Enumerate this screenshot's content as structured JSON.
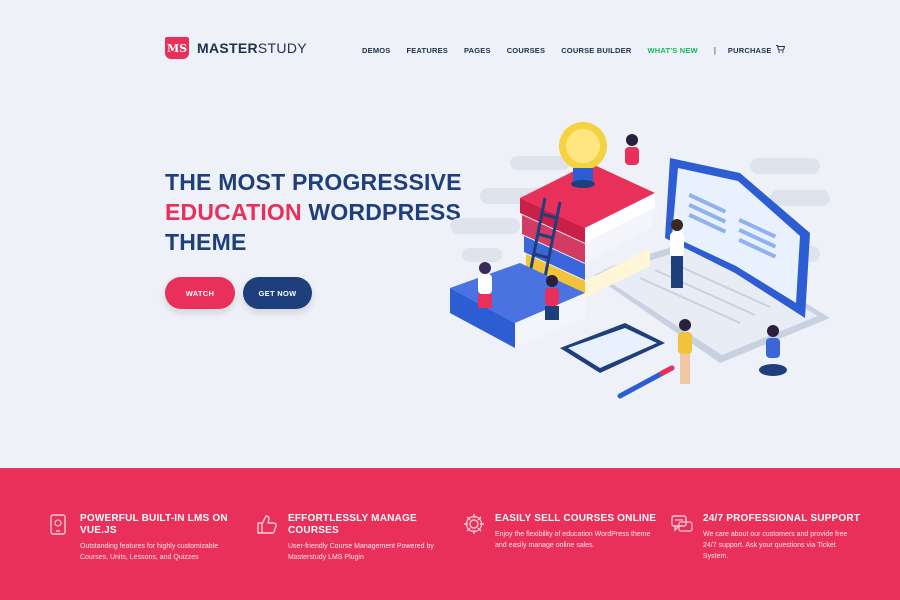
{
  "header": {
    "logo_badge": "MS",
    "logo_bold": "MASTER",
    "logo_light": "STUDY",
    "nav": {
      "demos": "DEMOS",
      "features": "FEATURES",
      "pages": "PAGES",
      "courses": "COURSES",
      "course_builder": "COURSE BUILDER",
      "whats_new": "WHAT'S NEW",
      "separator": "|",
      "purchase": "PURCHASE"
    },
    "cart_icon": "cart-icon"
  },
  "hero": {
    "line1": "THE MOST PROGRESSIVE",
    "line2_pink": "EDUCATION",
    "line2_rest": " WORDPRESS",
    "line3": "THEME",
    "watch_label": "WATCH",
    "get_now_label": "GET NOW"
  },
  "features": [
    {
      "title": "POWERFUL BUILT-IN LMS ON VUE.JS",
      "desc": "Outstanding features for highly customizable Courses, Units, Lessons, and Quizzes",
      "icon": "tablet-icon"
    },
    {
      "title": "EFFORTLESSLY MANAGE COURSES",
      "desc": "User-friendly Course Management Powered by Masterstudy LMS Plugin",
      "icon": "thumbs-up-icon"
    },
    {
      "title": "EASILY SELL COURSES ONLINE",
      "desc": "Enjoy the flexibility of education WordPress theme and easily manage online sales.",
      "icon": "gear-icon"
    },
    {
      "title": "24/7 PROFESSIONAL SUPPORT",
      "desc": "We care about our customers and provide free 24/7 support. Ask your questions via Ticket System.",
      "icon": "chat-icon"
    }
  ],
  "colors": {
    "accent": "#e8305a",
    "navy": "#1e3f7c",
    "green": "#18b85c",
    "background": "#eef1f8"
  }
}
